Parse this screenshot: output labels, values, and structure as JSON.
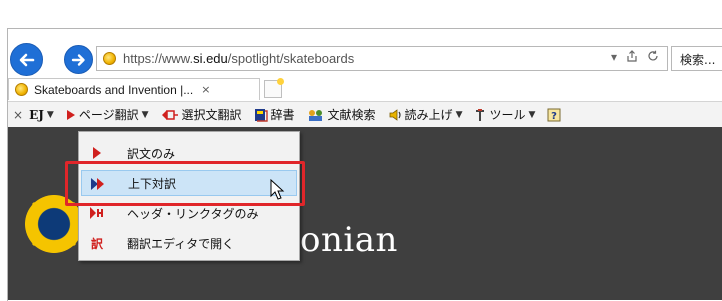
{
  "address_bar": {
    "url_prefix": "https://www.",
    "url_domain": "si.edu",
    "url_path": "/spotlight/skateboards",
    "dropdown_icon": "chevron-down-icon",
    "share_icon": "share-icon",
    "refresh_icon": "refresh-icon"
  },
  "search": {
    "placeholder": "検索..."
  },
  "tab": {
    "title": "Skateboards and Invention |...",
    "close": "×"
  },
  "toolbar": {
    "close": "×",
    "ej_label": "EJ",
    "page_translate": "ページ翻訳",
    "selection_translate": "選択文翻訳",
    "dictionary": "辞書",
    "literature_search": "文献検索",
    "read_aloud": "読み上げ",
    "tools": "ツール"
  },
  "menu": {
    "items": [
      {
        "label": "訳文のみ",
        "icon": "single-arrow-icon"
      },
      {
        "label": "上下対訳",
        "icon": "double-arrow-icon"
      },
      {
        "label": "ヘッダ・リンクタグのみ",
        "icon": "header-link-icon"
      },
      {
        "label": "翻訳エディタで開く",
        "icon": "editor-icon"
      }
    ]
  },
  "page": {
    "logo_text": "onian"
  },
  "colors": {
    "accent_blue": "#1f6fd6",
    "highlight_red": "#e0262a",
    "menu_hover": "#cce4f7",
    "page_dark": "#3f3f3f"
  }
}
